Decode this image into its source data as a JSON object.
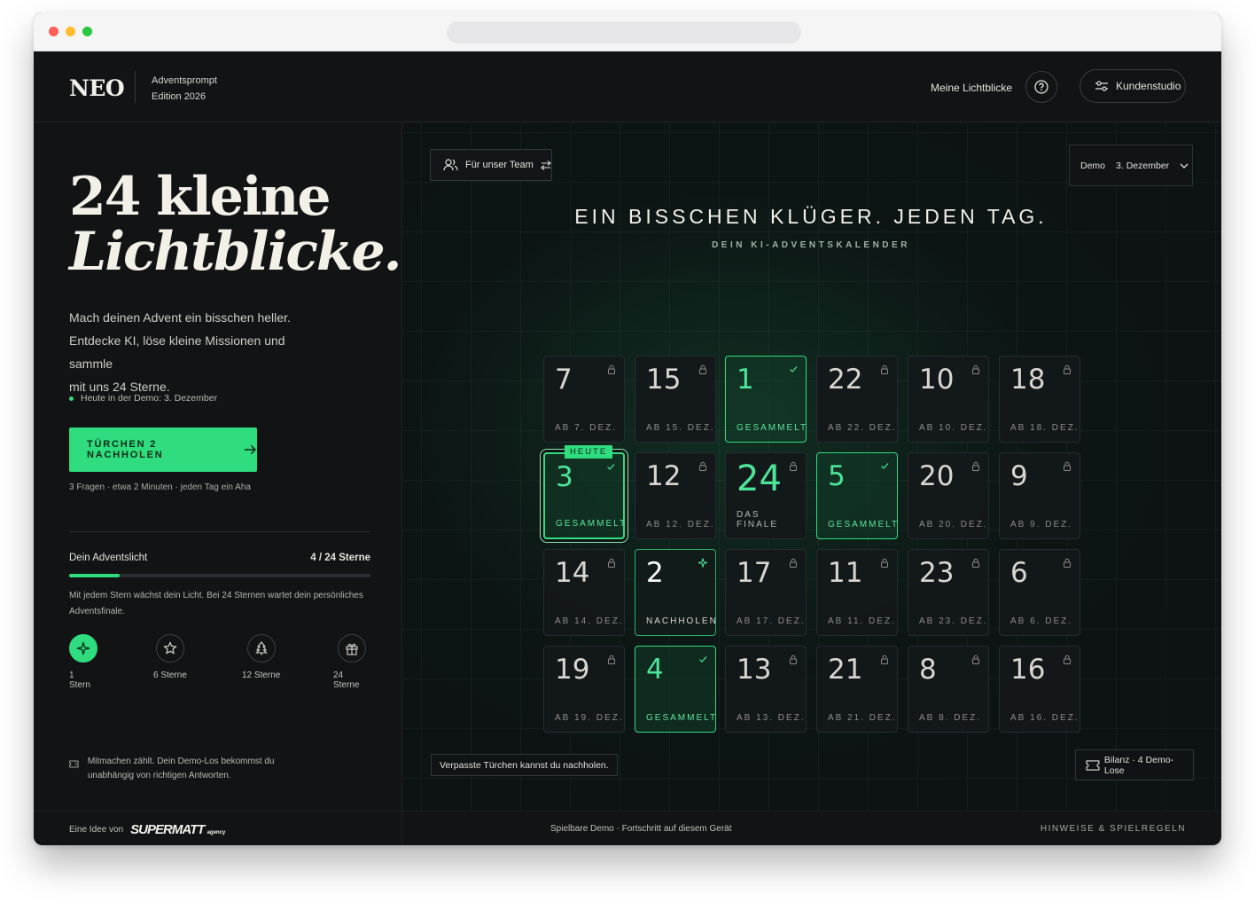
{
  "header": {
    "logo": "NEO",
    "edition_line1": "Adventsprompt",
    "edition_line2": "Edition 2026",
    "nav_link": "Meine Lichtblicke",
    "studio_button": "Kundenstudio"
  },
  "hero": {
    "title_line1": "24 kleine",
    "title_line2": "Lichtblicke.",
    "text_line1": "Mach deinen Advent ein bisschen heller.",
    "text_line2": "Entdecke KI, löse kleine Missionen und sammle",
    "text_line3": "mit uns 24 Sterne.",
    "today_note": "Heute in der Demo: 3. Dezember",
    "cta_label": "TÜRCHEN 2 NACHHOLEN",
    "cta_sub": "3 Fragen · etwa 2 Minuten · jeden Tag ein Aha"
  },
  "light": {
    "title": "Dein Adventslicht",
    "count": "4 / 24 Sterne",
    "progress_fraction": 0.1667,
    "text": "Mit jedem Stern wächst dein Licht. Bei 24 Sternen wartet dein persönliches Adventsfinale.",
    "milestones": [
      {
        "label": "1 Stern",
        "icon": "sparkle-icon",
        "active": true
      },
      {
        "label": "6 Sterne",
        "icon": "star-icon",
        "active": false
      },
      {
        "label": "12 Sterne",
        "icon": "tree-icon",
        "active": false
      },
      {
        "label": "24 Sterne",
        "icon": "gift-icon",
        "active": false
      }
    ]
  },
  "ticket_note": "Mitmachen zählt. Dein Demo-Los bekommst du unabhängig von richtigen Antworten.",
  "calendar": {
    "team_button": "Für unser Team",
    "demo_label": "Demo",
    "demo_date": "3. Dezember",
    "title": "EIN BISSCHEN KLÜGER. JEDEN TAG.",
    "subtitle": "DEIN KI-ADVENTSKALENDER",
    "today_tag": "HEUTE",
    "doors": [
      {
        "num": "7",
        "status": "AB 7. DEZ.",
        "state": "locked"
      },
      {
        "num": "15",
        "status": "AB 15. DEZ.",
        "state": "locked"
      },
      {
        "num": "1",
        "status": "GESAMMELT",
        "state": "collected"
      },
      {
        "num": "22",
        "status": "AB 22. DEZ.",
        "state": "locked"
      },
      {
        "num": "10",
        "status": "AB 10. DEZ.",
        "state": "locked"
      },
      {
        "num": "18",
        "status": "AB 18. DEZ.",
        "state": "locked"
      },
      {
        "num": "3",
        "status": "GESAMMELT",
        "state": "today"
      },
      {
        "num": "12",
        "status": "AB 12. DEZ.",
        "state": "locked"
      },
      {
        "num": "24",
        "status": "DAS FINALE",
        "state": "finale"
      },
      {
        "num": "5",
        "status": "GESAMMELT",
        "state": "collected"
      },
      {
        "num": "20",
        "status": "AB 20. DEZ.",
        "state": "locked"
      },
      {
        "num": "9",
        "status": "AB 9. DEZ.",
        "state": "locked"
      },
      {
        "num": "14",
        "status": "AB 14. DEZ.",
        "state": "locked"
      },
      {
        "num": "2",
        "status": "NACHHOLEN",
        "state": "makeup"
      },
      {
        "num": "17",
        "status": "AB 17. DEZ.",
        "state": "locked"
      },
      {
        "num": "11",
        "status": "AB 11. DEZ.",
        "state": "locked"
      },
      {
        "num": "23",
        "status": "AB 23. DEZ.",
        "state": "locked"
      },
      {
        "num": "6",
        "status": "AB 6. DEZ.",
        "state": "locked"
      },
      {
        "num": "19",
        "status": "AB 19. DEZ.",
        "state": "locked"
      },
      {
        "num": "4",
        "status": "GESAMMELT",
        "state": "collected"
      },
      {
        "num": "13",
        "status": "AB 13. DEZ.",
        "state": "locked"
      },
      {
        "num": "21",
        "status": "AB 21. DEZ.",
        "state": "locked"
      },
      {
        "num": "8",
        "status": "AB 8. DEZ.",
        "state": "locked"
      },
      {
        "num": "16",
        "status": "AB 16. DEZ.",
        "state": "locked"
      }
    ],
    "missed_note": "Verpasste Türchen kannst du nachholen.",
    "bilanz": "Bilanz · 4 Demo-Lose"
  },
  "footer": {
    "idea_prefix": "Eine Idee von",
    "brand": "SUPERMATT",
    "brand_sub": "agency",
    "center": "Spielbare Demo · Fortschritt auf diesem Gerät",
    "rules": "HINWEISE & SPIELREGELN"
  },
  "colors": {
    "accent": "#2fdc7e",
    "background": "#111315"
  }
}
